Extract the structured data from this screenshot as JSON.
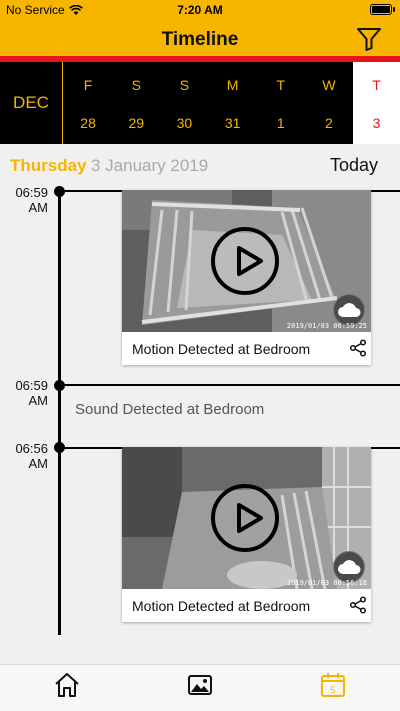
{
  "status_bar": {
    "carrier": "No Service",
    "time": "7:20 AM"
  },
  "nav": {
    "title": "Timeline",
    "filter_icon": "filter-icon"
  },
  "calendar": {
    "month": "DEC",
    "days": [
      {
        "dow": "F",
        "dom": "28"
      },
      {
        "dow": "S",
        "dom": "29"
      },
      {
        "dow": "S",
        "dom": "30"
      },
      {
        "dow": "M",
        "dom": "31"
      },
      {
        "dow": "T",
        "dom": "1"
      },
      {
        "dow": "W",
        "dom": "2"
      }
    ],
    "selected": {
      "dow": "T",
      "dom": "3"
    }
  },
  "date_header": {
    "weekday": "Thursday",
    "date": "3 January 2019",
    "today_label": "Today"
  },
  "events": [
    {
      "time": "06:59",
      "ampm": "AM",
      "type": "video",
      "caption": "Motion Detected at Bedroom",
      "stamp": "2019/01/03 06:59:25"
    },
    {
      "time": "06:59",
      "ampm": "AM",
      "type": "sound",
      "caption": "Sound Detected at Bedroom"
    },
    {
      "time": "06:56",
      "ampm": "AM",
      "type": "video",
      "caption": "Motion Detected at Bedroom",
      "stamp": "2019/01/03 06:56:18"
    }
  ],
  "tabbar": {
    "items": [
      "home-icon",
      "gallery-icon",
      "calendar-icon"
    ],
    "calendar_badge": "5"
  },
  "colors": {
    "accent": "#f7b500",
    "red": "#e8141b",
    "black": "#000000"
  }
}
